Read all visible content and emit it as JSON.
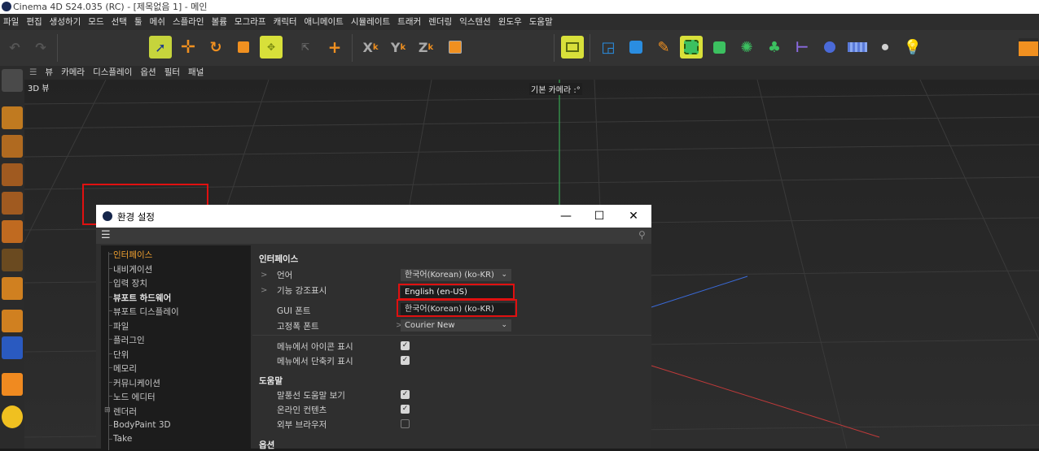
{
  "window": {
    "title": "Cinema 4D S24.035 (RC) - [제목없음 1] - 메인"
  },
  "menubar": [
    "파일",
    "편집",
    "생성하기",
    "모드",
    "선택",
    "툴",
    "메쉬",
    "스플라인",
    "볼륨",
    "모그라프",
    "캐릭터",
    "애니메이트",
    "시뮬레이트",
    "트래커",
    "렌더링",
    "익스텐션",
    "윈도우",
    "도움말"
  ],
  "toolbar": {
    "axis_x": "X",
    "axis_y": "Y",
    "axis_z": "Z",
    "sub_k": "k"
  },
  "viewport": {
    "menu": [
      "뷰",
      "카메라",
      "디스플레이",
      "옵션",
      "필터",
      "패널"
    ],
    "label": "3D 뷰",
    "camera_label": "기본 카메라 :°"
  },
  "dialog": {
    "title": "환경 설정",
    "tree": [
      "인터페이스",
      "내비게이션",
      "입력 장치",
      "뷰포트 하드웨어",
      "뷰포트 디스플레이",
      "파일",
      "플러그인",
      "단위",
      "메모리",
      "커뮤니케이션",
      "노드 에디터",
      "렌더러",
      "BodyPaint 3D",
      "Take"
    ],
    "section_interface": "인터페이스",
    "language_label": "언어",
    "language_value": "한국어(Korean) (ko-KR)",
    "highlight_label": "기능 강조표시",
    "option_en": "English (en-US)",
    "option_ko": "한국어(Korean) (ko-KR)",
    "gui_font_label": "GUI 폰트",
    "mono_font_label": "고정폭 폰트",
    "mono_font_value": "Courier New",
    "icons_menu_label": "메뉴에서 아이콘 표시",
    "shortcuts_menu_label": "메뉴에서 단축키 표시",
    "section_help": "도움말",
    "bubble_help_label": "말풍선 도움말 보기",
    "online_content_label": "온라인 컨텐츠",
    "external_browser_label": "외부 브라우저",
    "section_options": "옵션",
    "checkboxes": {
      "icons_menu": true,
      "shortcuts_menu": true,
      "bubble_help": true,
      "online_content": true,
      "external_browser": false
    }
  },
  "colors": {
    "accent_orange": "#f0a030",
    "highlight_red": "#e01010",
    "toolbar_yellow": "#d8e03a"
  }
}
